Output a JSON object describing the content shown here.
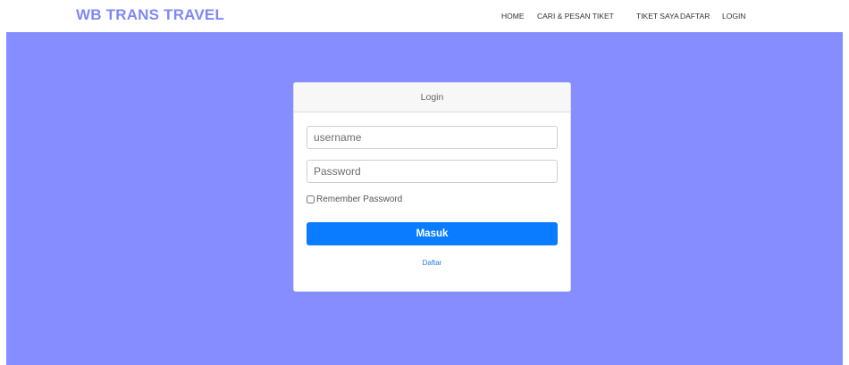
{
  "header": {
    "logo": "WB TRANS TRAVEL",
    "nav": [
      "HOME",
      "CARI & PESAN TIKET",
      "TIKET SAYA",
      "DAFTAR",
      "LOGIN"
    ]
  },
  "login": {
    "title": "Login",
    "username_placeholder": "username",
    "password_placeholder": "Password",
    "remember_label": "Remember Password",
    "submit_label": "Masuk",
    "register_link": "Daftar"
  },
  "colors": {
    "logo": "#7f88f6",
    "background": "#868eff",
    "button": "#0a7cff",
    "link": "#1f7df0"
  }
}
